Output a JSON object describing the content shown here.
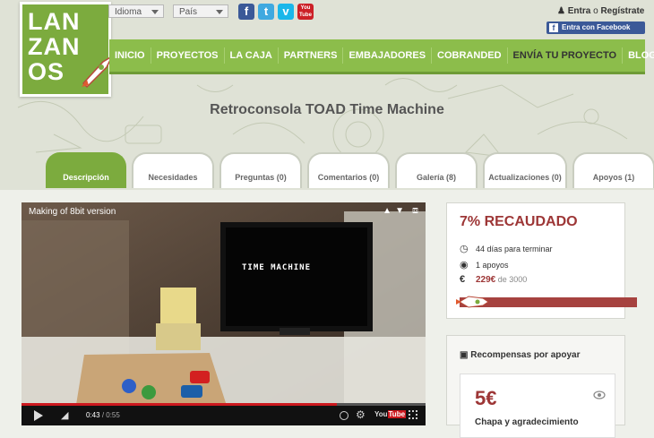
{
  "logo": {
    "lines": [
      "LAN",
      "ZAN",
      "OS"
    ]
  },
  "header": {
    "idioma": "Idioma",
    "pais": "País",
    "social": [
      "facebook-icon",
      "twitter-icon",
      "vimeo-icon",
      "youtube-icon"
    ],
    "youtube_text": "You\nTube",
    "login": {
      "entra": "Entra",
      "o": "o",
      "registrate": "Regístrate"
    },
    "facebook_login": "Entra con Facebook"
  },
  "nav": [
    "INICIO",
    "PROYECTOS",
    "LA CAJA",
    "PARTNERS",
    "EMBAJADORES",
    "COBRANDED",
    "ENVÍA TU PROYECTO",
    "BLOG"
  ],
  "project_title": "Retroconsola TOAD Time Machine",
  "tabs": [
    "Descripción",
    "Necesidades",
    "Preguntas (0)",
    "Comentarios (0)",
    "Galería (8)",
    "Actualizaciones (0)",
    "Apoyos (1)"
  ],
  "video": {
    "title": "Making of 8bit version",
    "screen_logo": "TIME MACHINE",
    "time_current": "0:43",
    "time_total": "/ 0:55",
    "progress": 0.78
  },
  "funding": {
    "percent_label": "7% RECAUDADO",
    "days": "44 días para terminar",
    "backers": "1 apoyos",
    "amount": "229€",
    "goal": "de 3000",
    "progress": 0.07,
    "bar_color": "#a6423f",
    "accent": "#9d3636"
  },
  "rewards": {
    "heading": "Recompensas por apoyar",
    "items": [
      {
        "price": "5€",
        "description": "Chapa y agradecimiento"
      }
    ]
  }
}
